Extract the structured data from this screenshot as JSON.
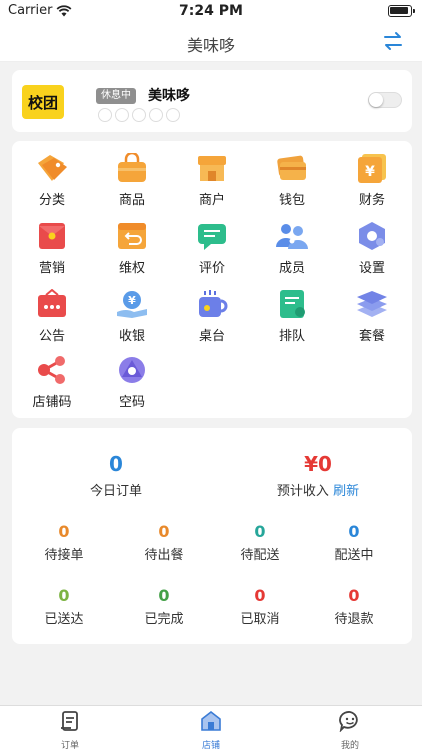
{
  "status_bar": {
    "carrier": "Carrier",
    "time": "7:24 PM"
  },
  "nav": {
    "title": "美味哆"
  },
  "store": {
    "logo_text": "校团",
    "status_badge": "休息中",
    "name": "美味哆"
  },
  "functions": [
    {
      "label": "分类",
      "icon": "tag-icon"
    },
    {
      "label": "商品",
      "icon": "bag-icon"
    },
    {
      "label": "商户",
      "icon": "storefront-icon"
    },
    {
      "label": "钱包",
      "icon": "wallet-icon"
    },
    {
      "label": "财务",
      "icon": "yen-doc-icon"
    },
    {
      "label": "营销",
      "icon": "red-envelope-icon"
    },
    {
      "label": "维权",
      "icon": "return-box-icon"
    },
    {
      "label": "评价",
      "icon": "chat-bubble-icon"
    },
    {
      "label": "成员",
      "icon": "members-icon"
    },
    {
      "label": "设置",
      "icon": "hexagon-gear-icon"
    },
    {
      "label": "公告",
      "icon": "announcement-icon"
    },
    {
      "label": "收银",
      "icon": "cash-hand-icon"
    },
    {
      "label": "桌台",
      "icon": "coffee-cup-icon"
    },
    {
      "label": "排队",
      "icon": "queue-doc-icon"
    },
    {
      "label": "套餐",
      "icon": "layers-icon"
    },
    {
      "label": "店铺码",
      "icon": "share-icon"
    },
    {
      "label": "空码",
      "icon": "triangle-circle-icon"
    }
  ],
  "stats": {
    "today_orders": {
      "value": "0",
      "label": "今日订单"
    },
    "expected_income": {
      "value": "¥0",
      "label": "预计收入",
      "refresh": "刷新"
    },
    "items": [
      {
        "value": "0",
        "label": "待接单",
        "color": "#e8892b"
      },
      {
        "value": "0",
        "label": "待出餐",
        "color": "#e8892b"
      },
      {
        "value": "0",
        "label": "待配送",
        "color": "#26a69a"
      },
      {
        "value": "0",
        "label": "配送中",
        "color": "#2a86d8"
      },
      {
        "value": "0",
        "label": "已送达",
        "color": "#7cb342"
      },
      {
        "value": "0",
        "label": "已完成",
        "color": "#43a047"
      },
      {
        "value": "0",
        "label": "已取消",
        "color": "#e53935"
      },
      {
        "value": "0",
        "label": "待退款",
        "color": "#e53935"
      }
    ]
  },
  "tabs": [
    {
      "label": "订单",
      "icon": "order-doc-icon"
    },
    {
      "label": "店铺",
      "icon": "store-icon"
    },
    {
      "label": "我的",
      "icon": "smile-chat-icon"
    }
  ],
  "colors": {
    "accent": "#2a86d8",
    "logo_bg": "#f9d21d",
    "price": "#e53935"
  }
}
